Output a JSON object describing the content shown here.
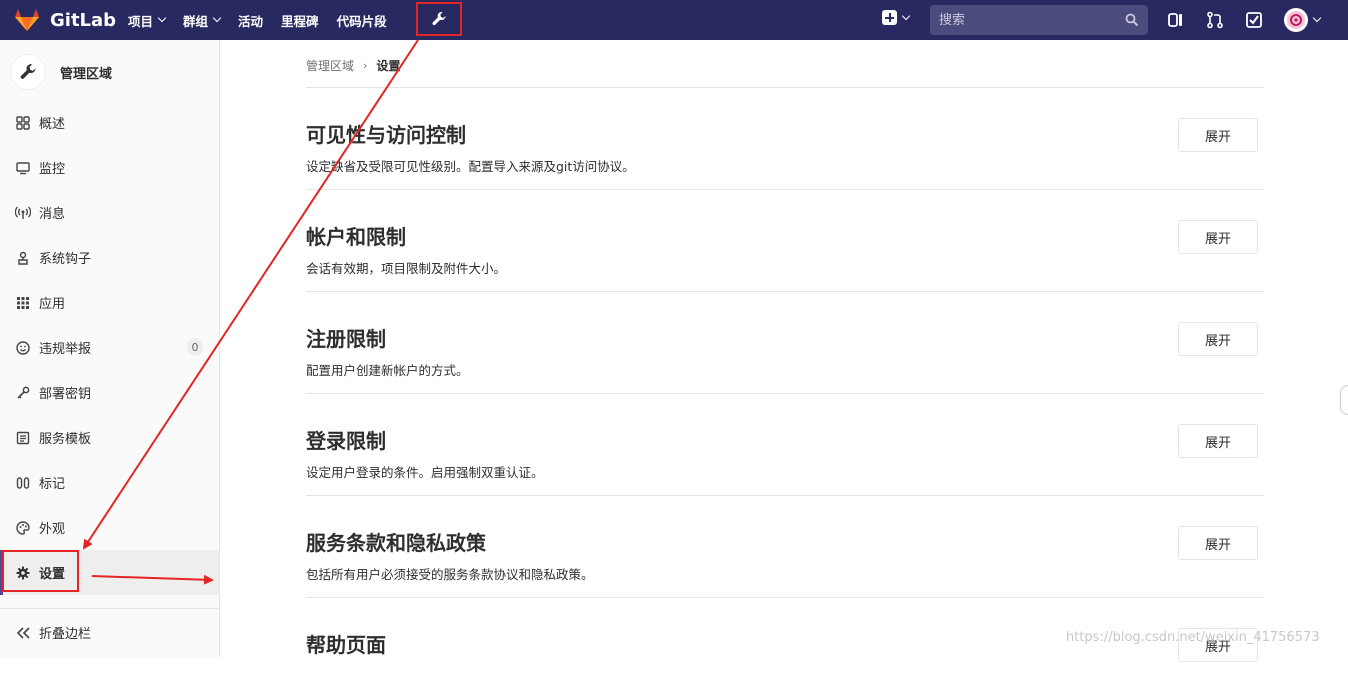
{
  "app": {
    "name": "GitLab"
  },
  "nav": {
    "items": [
      {
        "label": "项目",
        "dropdown": true
      },
      {
        "label": "群组",
        "dropdown": true
      },
      {
        "label": "活动",
        "dropdown": false
      },
      {
        "label": "里程碑",
        "dropdown": false
      },
      {
        "label": "代码片段",
        "dropdown": false
      }
    ]
  },
  "search": {
    "placeholder": "搜索"
  },
  "sidebar": {
    "title": "管理区域",
    "items": [
      {
        "label": "概述",
        "icon": "overview-icon"
      },
      {
        "label": "监控",
        "icon": "monitor-icon"
      },
      {
        "label": "消息",
        "icon": "broadcast-icon"
      },
      {
        "label": "系统钩子",
        "icon": "hook-icon"
      },
      {
        "label": "应用",
        "icon": "apps-grid-icon"
      },
      {
        "label": "违规举报",
        "icon": "smiley-icon",
        "count": "0"
      },
      {
        "label": "部署密钥",
        "icon": "key-icon"
      },
      {
        "label": "服务模板",
        "icon": "template-icon"
      },
      {
        "label": "标记",
        "icon": "labels-icon"
      },
      {
        "label": "外观",
        "icon": "palette-icon"
      },
      {
        "label": "设置",
        "icon": "gear-icon",
        "active": true
      }
    ],
    "collapse_label": "折叠边栏"
  },
  "breadcrumb": {
    "parent": "管理区域",
    "current": "设置"
  },
  "sections": [
    {
      "title": "可见性与访问控制",
      "description": "设定缺省及受限可见性级别。配置导入来源及git访问协议。",
      "button": "展开"
    },
    {
      "title": "帐户和限制",
      "description": "会话有效期，项目限制及附件大小。",
      "button": "展开"
    },
    {
      "title": "注册限制",
      "description": "配置用户创建新帐户的方式。",
      "button": "展开"
    },
    {
      "title": "登录限制",
      "description": "设定用户登录的条件。启用强制双重认证。",
      "button": "展开"
    },
    {
      "title": "服务条款和隐私政策",
      "description": "包括所有用户必须接受的服务条款协议和隐私政策。",
      "button": "展开"
    },
    {
      "title": "帮助页面",
      "description": "",
      "button": "展开"
    }
  ],
  "watermark": "https://blog.csdn.net/weixin_41756573",
  "colors": {
    "topbar": "#292961",
    "annotation": "#e42525",
    "search": "#4b4b7d"
  }
}
